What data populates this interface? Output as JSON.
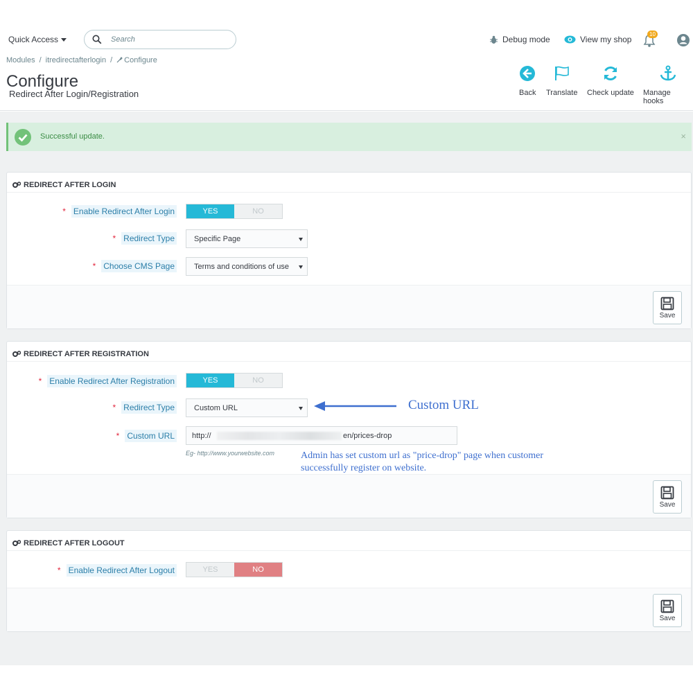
{
  "header": {
    "quick_access": "Quick Access",
    "search_placeholder": "Search",
    "debug_mode": "Debug mode",
    "view_my_shop": "View my shop",
    "notification_count": "10"
  },
  "breadcrumb": [
    "Modules",
    "/",
    "itredirectafterlogin",
    "/",
    "Configure"
  ],
  "page": {
    "title": "Configure",
    "subtitle": "Redirect After Login/Registration"
  },
  "toolbar": {
    "back": "Back",
    "translate": "Translate",
    "check_update": "Check update",
    "manage_hooks": "Manage hooks"
  },
  "alert": {
    "message": "Successful update.",
    "close": "×"
  },
  "panels": {
    "login": {
      "heading": "REDIRECT AFTER LOGIN",
      "enable_label": "Enable Redirect After Login",
      "enable_yes": "YES",
      "enable_no": "NO",
      "enable_value": "YES",
      "type_label": "Redirect Type",
      "type_value": "Specific Page",
      "cms_label": "Choose CMS Page",
      "cms_value": "Terms and conditions of use",
      "save": "Save"
    },
    "registration": {
      "heading": "REDIRECT AFTER REGISTRATION",
      "enable_label": "Enable Redirect After Registration",
      "enable_yes": "YES",
      "enable_no": "NO",
      "enable_value": "YES",
      "type_label": "Redirect Type",
      "type_value": "Custom URL",
      "url_label": "Custom URL",
      "url_prefix": "http://",
      "url_suffix": "en/prices-drop",
      "url_help": "Eg- http://www.yourwebsite.com",
      "save": "Save"
    },
    "logout": {
      "heading": "REDIRECT AFTER LOGOUT",
      "enable_label": "Enable Redirect After Logout",
      "enable_yes": "YES",
      "enable_no": "NO",
      "enable_value": "NO",
      "save": "Save"
    }
  },
  "annotations": {
    "custom_url": "Custom URL",
    "note": "Admin has set custom url as \"price-drop\" page when customer successfully register on website."
  },
  "colors": {
    "accent": "#25b9d7",
    "success": "#72c279",
    "danger": "#e08083",
    "annotation": "#3e6fcf"
  }
}
